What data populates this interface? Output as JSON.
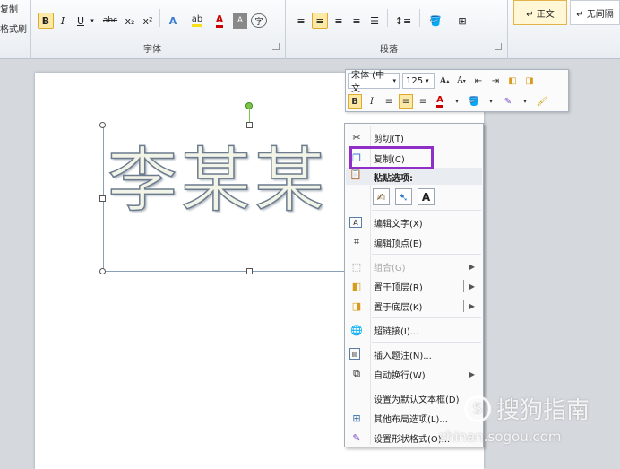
{
  "ribbon": {
    "clipboard_copy": "复制",
    "clipboard_format_painter": "格式刷",
    "font_group_label": "字体",
    "paragraph_group_label": "段落",
    "style_normal": "↵ 正文",
    "style_no_spacing": "↵ 无间隔",
    "bold": "B",
    "italic": "I",
    "underline": "U",
    "strike": "abc",
    "subscript": "x₂",
    "superscript": "x²"
  },
  "document": {
    "wordart_text": "李某某"
  },
  "mini_toolbar": {
    "font_name": "宋体 (中文",
    "font_size": "125",
    "bold": "B",
    "italic": "I"
  },
  "context_menu": {
    "items": {
      "cut": "剪切(T)",
      "copy": "复制(C)",
      "paste_header": "粘贴选项:",
      "edit_text": "编辑文字(X)",
      "edit_points": "编辑顶点(E)",
      "group": "组合(G)",
      "bring_front": "置于顶层(R)",
      "send_back": "置于底层(K)",
      "hyperlink": "超链接(I)...",
      "insert_caption": "插入题注(N)...",
      "wrap_text": "自动换行(W)",
      "set_default_textbox": "设置为默认文本框(D)",
      "more_layout": "其他布局选项(L)...",
      "format_shape": "设置形状格式(O)..."
    }
  },
  "watermark": {
    "brand": "搜狗指南",
    "url": "zhinan.sogou.com"
  },
  "colors": {
    "highlight_border": "#8f2fc7",
    "accent_orange": "#e0a82f"
  }
}
